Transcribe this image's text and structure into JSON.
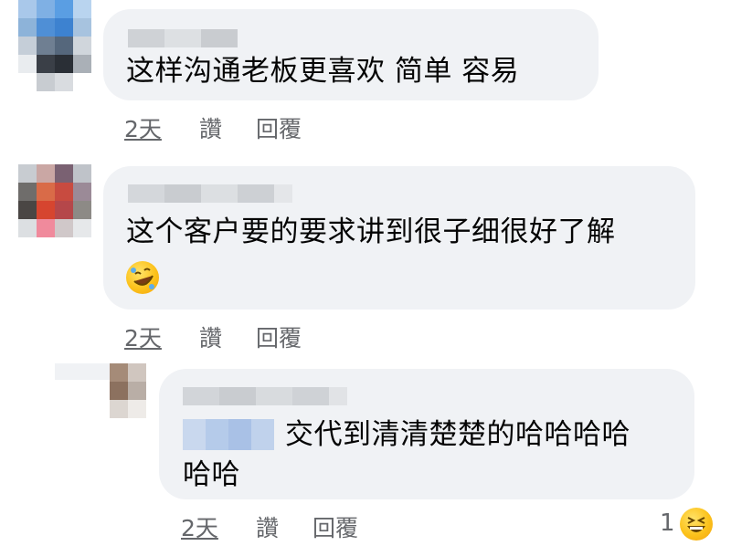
{
  "comments": [
    {
      "text_lines": [
        "这样沟通老板更喜欢  简单  容易"
      ],
      "time": "2天",
      "like": "讚",
      "reply": "回覆"
    },
    {
      "text_lines": [
        "这个客户要的要求讲到很子细很好了解"
      ],
      "emoji_icon": "rolling-on-floor-laughing-emoji",
      "time": "2天",
      "like": "讚",
      "reply": "回覆"
    },
    {
      "mention": "blurred-name",
      "text_lines": [
        "交代到清清楚楚的哈哈哈哈",
        "哈哈"
      ],
      "time": "2天",
      "like": "讚",
      "reply": "回覆",
      "reaction": {
        "count": "1",
        "icon": "grinning-squinting-emoji"
      }
    }
  ]
}
